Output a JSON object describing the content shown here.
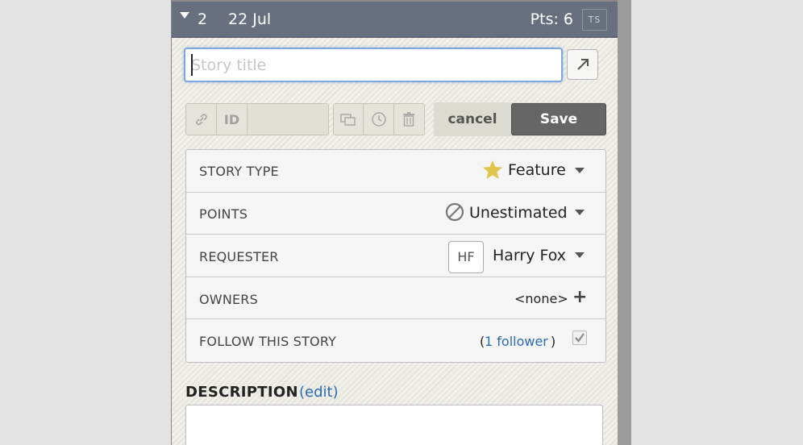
{
  "header": {
    "number": "2",
    "date": "22 Jul",
    "points": "Pts: 6",
    "ts_label": "TS"
  },
  "title_input": {
    "value": "",
    "placeholder": "Story title"
  },
  "toolbar": {
    "id_label": "ID",
    "id_value": "",
    "cancel_label": "cancel",
    "save_label": "Save"
  },
  "fields": {
    "story_type": {
      "label": "STORY TYPE",
      "value": "Feature",
      "icon": "star-icon",
      "icon_color": "#e2c44c"
    },
    "points": {
      "label": "POINTS",
      "value": "Unestimated",
      "icon": "unestimated-icon"
    },
    "requester": {
      "label": "REQUESTER",
      "initials": "HF",
      "name": "Harry Fox"
    },
    "owners": {
      "label": "OWNERS",
      "value": "<none>",
      "add_symbol": "+"
    },
    "follow": {
      "label": "FOLLOW THIS STORY",
      "paren_open": "(",
      "followers": "1 follower",
      "paren_close": ")",
      "checked": true
    }
  },
  "description": {
    "heading": "DESCRIPTION",
    "edit_label": "(edit)",
    "value": ""
  },
  "colors": {
    "header_bg": "#687080",
    "save_bg": "#666666",
    "link": "#2a6bb0",
    "focus_border": "#7da8dd"
  }
}
